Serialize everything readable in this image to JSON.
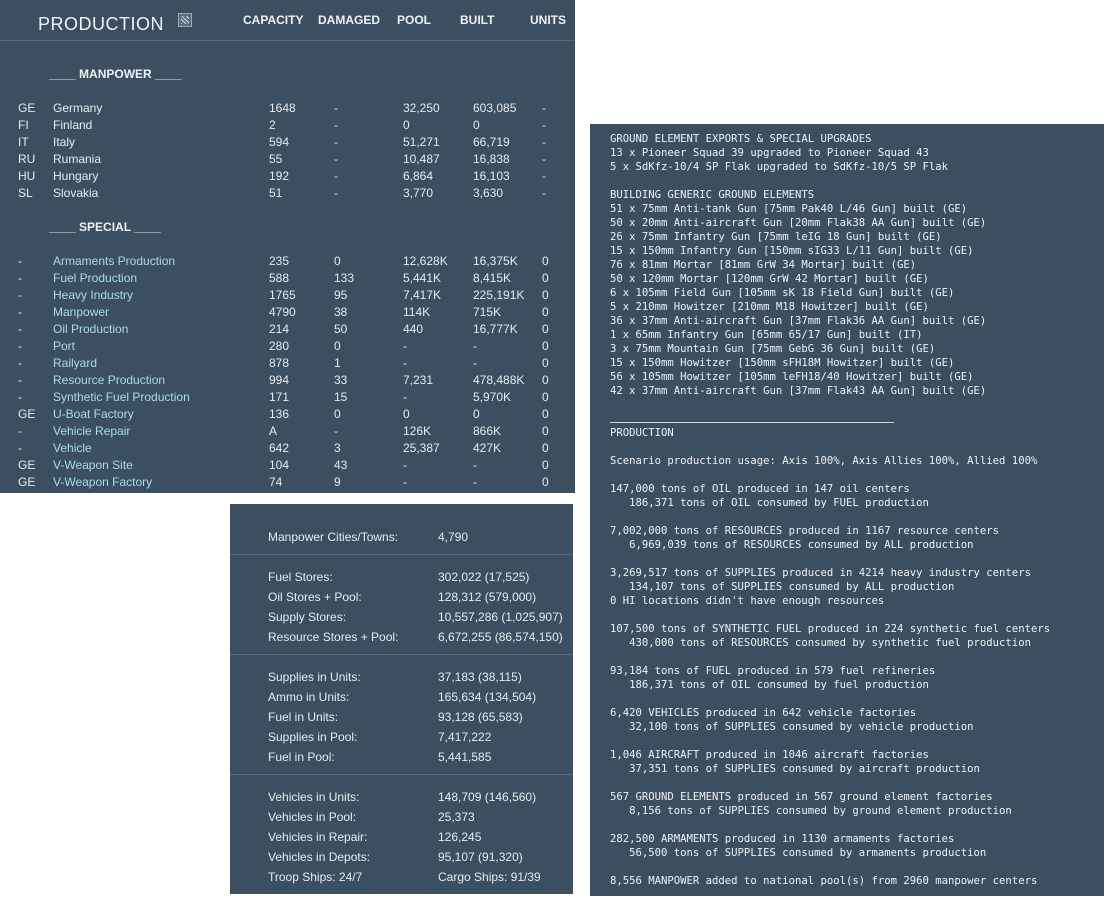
{
  "production": {
    "title": "PRODUCTION",
    "columns": {
      "capacity": "CAPACITY",
      "damaged": "DAMAGED",
      "pool": "POOL",
      "built": "BUILT",
      "units": "UNITS"
    },
    "manpower_header": "____ MANPOWER ____",
    "special_header": "____ SPECIAL ____",
    "manpower_rows": [
      {
        "code": "GE",
        "name": "Germany",
        "capacity": "1648",
        "damaged": "-",
        "pool": "32,250",
        "built": "603,085",
        "units": "-"
      },
      {
        "code": "FI",
        "name": "Finland",
        "capacity": "2",
        "damaged": "-",
        "pool": "0",
        "built": "0",
        "units": "-"
      },
      {
        "code": "IT",
        "name": "Italy",
        "capacity": "594",
        "damaged": "-",
        "pool": "51,271",
        "built": "66,719",
        "units": "-"
      },
      {
        "code": "RU",
        "name": "Rumania",
        "capacity": "55",
        "damaged": "-",
        "pool": "10,487",
        "built": "16,838",
        "units": "-"
      },
      {
        "code": "HU",
        "name": "Hungary",
        "capacity": "192",
        "damaged": "-",
        "pool": "6,864",
        "built": "16,103",
        "units": "-"
      },
      {
        "code": "SL",
        "name": "Slovakia",
        "capacity": "51",
        "damaged": "-",
        "pool": "3,770",
        "built": "3,630",
        "units": "-"
      }
    ],
    "special_rows": [
      {
        "code": "-",
        "name": "Armaments Production",
        "capacity": "235",
        "damaged": "0",
        "pool": "12,628K",
        "built": "16,375K",
        "units": "0"
      },
      {
        "code": "-",
        "name": "Fuel Production",
        "capacity": "588",
        "damaged": "133",
        "pool": "5,441K",
        "built": "8,415K",
        "units": "0"
      },
      {
        "code": "-",
        "name": "Heavy Industry",
        "capacity": "1765",
        "damaged": "95",
        "pool": "7,417K",
        "built": "225,191K",
        "units": "0"
      },
      {
        "code": "-",
        "name": "Manpower",
        "capacity": "4790",
        "damaged": "38",
        "pool": "114K",
        "built": "715K",
        "units": "0"
      },
      {
        "code": "-",
        "name": "Oil Production",
        "capacity": "214",
        "damaged": "50",
        "pool": "440",
        "built": "16,777K",
        "units": "0"
      },
      {
        "code": "-",
        "name": "Port",
        "capacity": "280",
        "damaged": "0",
        "pool": "-",
        "built": "-",
        "units": "0"
      },
      {
        "code": "-",
        "name": "Railyard",
        "capacity": "878",
        "damaged": "1",
        "pool": "-",
        "built": "-",
        "units": "0"
      },
      {
        "code": "-",
        "name": "Resource Production",
        "capacity": "994",
        "damaged": "33",
        "pool": "7,231",
        "built": "478,488K",
        "units": "0"
      },
      {
        "code": "-",
        "name": "Synthetic Fuel Production",
        "capacity": "171",
        "damaged": "15",
        "pool": "-",
        "built": "5,970K",
        "units": "0"
      },
      {
        "code": "GE",
        "name": "U-Boat Factory",
        "capacity": "136",
        "damaged": "0",
        "pool": "0",
        "built": "0",
        "units": "0"
      },
      {
        "code": "-",
        "name": "Vehicle Repair",
        "capacity": "A",
        "damaged": "-",
        "pool": "126K",
        "built": "866K",
        "units": "0"
      },
      {
        "code": "-",
        "name": "Vehicle",
        "capacity": "642",
        "damaged": "3",
        "pool": "25,387",
        "built": "427K",
        "units": "0"
      },
      {
        "code": "GE",
        "name": "V-Weapon Site",
        "capacity": "104",
        "damaged": "43",
        "pool": "-",
        "built": "-",
        "units": "0"
      },
      {
        "code": "GE",
        "name": "V-Weapon Factory",
        "capacity": "74",
        "damaged": "9",
        "pool": "-",
        "built": "-",
        "units": "0"
      }
    ]
  },
  "stores": {
    "rows": [
      {
        "label": "Manpower Cities/Towns:",
        "value": "4,790"
      },
      {
        "label": "Fuel Stores:",
        "value": "302,022 (17,525)"
      },
      {
        "label": "Oil Stores + Pool:",
        "value": "128,312 (579,000)"
      },
      {
        "label": "Supply Stores:",
        "value": "10,557,286 (1,025,907)"
      },
      {
        "label": "Resource Stores + Pool:",
        "value": "6,672,255 (86,574,150)"
      },
      {
        "label": "Supplies in Units:",
        "value": "37,183 (38,115)"
      },
      {
        "label": "Ammo in Units:",
        "value": "165,634 (134,504)"
      },
      {
        "label": "Fuel in Units:",
        "value": "93,128 (65,583)"
      },
      {
        "label": "Supplies in Pool:",
        "value": "7,417,222"
      },
      {
        "label": "Fuel in Pool:",
        "value": "5,441,585"
      },
      {
        "label": "Vehicles in Units:",
        "value": "148,709 (146,560)"
      },
      {
        "label": "Vehicles in Pool:",
        "value": "25,373"
      },
      {
        "label": "Vehicles in Repair:",
        "value": "126,245"
      },
      {
        "label": "Vehicles in Depots:",
        "value": "95,107 (91,320)"
      },
      {
        "label": "Troop Ships: 24/7",
        "value": "Cargo Ships: 91/39"
      }
    ]
  },
  "log": {
    "text": "GROUND ELEMENT EXPORTS & SPECIAL UPGRADES\n13 x Pioneer Squad 39 upgraded to Pioneer Squad 43\n5 x SdKfz-10/4 SP Flak upgraded to SdKfz-10/5 SP Flak\n\nBUILDING GENERIC GROUND ELEMENTS\n51 x 75mm Anti-tank Gun [75mm Pak40 L/46 Gun] built (GE)\n50 x 20mm Anti-aircraft Gun [20mm Flak38 AA Gun] built (GE)\n26 x 75mm Infantry Gun [75mm leIG 18 Gun] built (GE)\n15 x 150mm Infantry Gun [150mm sIG33 L/11 Gun] built (GE)\n76 x 81mm Mortar [81mm GrW 34 Mortar] built (GE)\n50 x 120mm Mortar [120mm GrW 42 Mortar] built (GE)\n6 x 105mm Field Gun [105mm sK 18 Field Gun] built (GE)\n5 x 210mm Howitzer [210mm M18 Howitzer] built (GE)\n36 x 37mm Anti-aircraft Gun [37mm Flak36 AA Gun] built (GE)\n1 x 65mm Infantry Gun [65mm 65/17 Gun] built (IT)\n3 x 75mm Mountain Gun [75mm GebG 36 Gun] built (GE)\n15 x 150mm Howitzer [150mm sFH18M Howitzer] built (GE)\n56 x 105mm Howitzer [105mm leFH18/40 Howitzer] built (GE)\n42 x 37mm Anti-aircraft Gun [37mm Flak43 AA Gun] built (GE)\n\n\nPRODUCTION\n\nScenario production usage: Axis 100%, Axis Allies 100%, Allied 100%\n\n147,000 tons of OIL produced in 147 oil centers\n   186,371 tons of OIL consumed by FUEL production\n\n7,002,000 tons of RESOURCES produced in 1167 resource centers\n   6,969,039 tons of RESOURCES consumed by ALL production\n\n3,269,517 tons of SUPPLIES produced in 4214 heavy industry centers\n   134,107 tons of SUPPLIES consumed by ALL production\n0 HI locations didn't have enough resources\n\n107,500 tons of SYNTHETIC FUEL produced in 224 synthetic fuel centers\n   430,000 tons of RESOURCES consumed by synthetic fuel production\n\n93,184 tons of FUEL produced in 579 fuel refineries\n   186,371 tons of OIL consumed by fuel production\n\n6,420 VEHICLES produced in 642 vehicle factories\n   32,100 tons of SUPPLIES consumed by vehicle production\n\n1,046 AIRCRAFT produced in 1046 aircraft factories\n   37,351 tons of SUPPLIES consumed by aircraft production\n\n567 GROUND ELEMENTS produced in 567 ground element factories\n   8,156 tons of SUPPLIES consumed by ground element production\n\n282,500 ARMAMENTS produced in 1130 armaments factories\n   56,500 tons of SUPPLIES consumed by armaments production\n\n8,556 MANPOWER added to national pool(s) from 2960 manpower centers"
  }
}
